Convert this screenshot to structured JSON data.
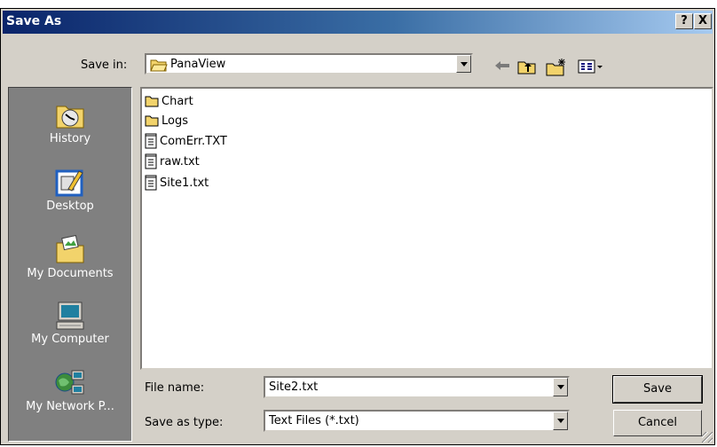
{
  "window": {
    "title": "Save As",
    "help_label": "?",
    "close_label": "X"
  },
  "toolbar": {
    "save_in_label": "Save in:",
    "save_in_value": "PanaView",
    "icons": [
      "back-arrow-icon",
      "up-folder-icon",
      "new-folder-icon",
      "view-menu-icon"
    ]
  },
  "places": [
    {
      "label": "History",
      "icon": "history-icon"
    },
    {
      "label": "Desktop",
      "icon": "desktop-icon"
    },
    {
      "label": "My Documents",
      "icon": "my-documents-icon"
    },
    {
      "label": "My Computer",
      "icon": "my-computer-icon"
    },
    {
      "label": "My Network P...",
      "icon": "network-places-icon"
    }
  ],
  "files": [
    {
      "name": "Chart",
      "type": "folder"
    },
    {
      "name": "Logs",
      "type": "folder"
    },
    {
      "name": "ComErr.TXT",
      "type": "text"
    },
    {
      "name": "raw.txt",
      "type": "text"
    },
    {
      "name": "Site1.txt",
      "type": "text"
    }
  ],
  "form": {
    "file_name_label": "File name:",
    "file_name_value": "Site2.txt",
    "type_label": "Save as type:",
    "type_value": "Text Files (*.txt)"
  },
  "buttons": {
    "save": "Save",
    "cancel": "Cancel"
  },
  "colors": {
    "title_start": "#0a246a",
    "title_end": "#a6caf0",
    "dialog_face": "#d4d0c8",
    "places_bg": "#808080"
  }
}
